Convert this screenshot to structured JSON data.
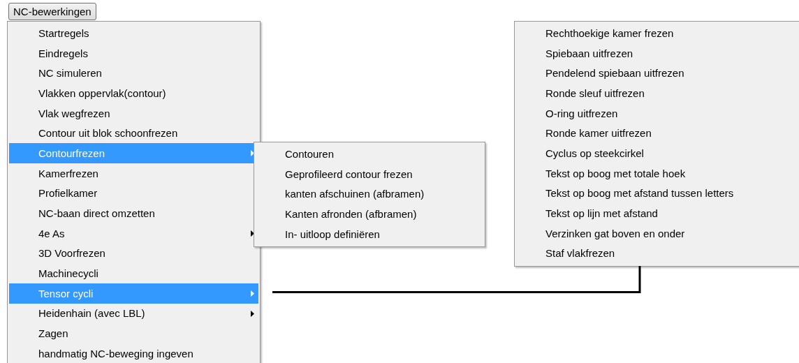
{
  "menu_button": {
    "label": "NC-bewerkingen"
  },
  "main_menu": {
    "items": [
      {
        "label": "Startregels",
        "selected": false,
        "has_submenu": false
      },
      {
        "label": "Eindregels",
        "selected": false,
        "has_submenu": false
      },
      {
        "label": "NC simuleren",
        "selected": false,
        "has_submenu": false
      },
      {
        "label": "Vlakken oppervlak(contour)",
        "selected": false,
        "has_submenu": false
      },
      {
        "label": "Vlak wegfrezen",
        "selected": false,
        "has_submenu": false
      },
      {
        "label": "Contour uit blok schoonfrezen",
        "selected": false,
        "has_submenu": false
      },
      {
        "label": "Contourfrezen",
        "selected": true,
        "has_submenu": true
      },
      {
        "label": "Kamerfrezen",
        "selected": false,
        "has_submenu": false
      },
      {
        "label": "Profielkamer",
        "selected": false,
        "has_submenu": false
      },
      {
        "label": "NC-baan direct omzetten",
        "selected": false,
        "has_submenu": false
      },
      {
        "label": "4e As",
        "selected": false,
        "has_submenu": true
      },
      {
        "label": "3D Voorfrezen",
        "selected": false,
        "has_submenu": false
      },
      {
        "label": "Machinecycli",
        "selected": false,
        "has_submenu": false
      },
      {
        "label": "Tensor cycli",
        "selected": true,
        "has_submenu": true
      },
      {
        "label": "Heidenhain (avec LBL)",
        "selected": false,
        "has_submenu": true
      },
      {
        "label": "Zagen",
        "selected": false,
        "has_submenu": false
      },
      {
        "label": "handmatig NC-beweging ingeven",
        "selected": false,
        "has_submenu": false
      }
    ]
  },
  "contourfrezen_submenu": {
    "items": [
      {
        "label": "Contouren",
        "selected": false,
        "has_submenu": false
      },
      {
        "label": "Geprofileerd contour frezen",
        "selected": false,
        "has_submenu": false
      },
      {
        "label": "kanten afschuinen (afbramen)",
        "selected": false,
        "has_submenu": false
      },
      {
        "label": "Kanten afronden (afbramen)",
        "selected": false,
        "has_submenu": false
      },
      {
        "label": "In- uitloop definiëren",
        "selected": false,
        "has_submenu": false
      }
    ]
  },
  "tensor_cycli_submenu": {
    "items": [
      {
        "label": "Rechthoekige kamer frezen",
        "selected": false,
        "has_submenu": false
      },
      {
        "label": "Spiebaan uitfrezen",
        "selected": false,
        "has_submenu": false
      },
      {
        "label": "Pendelend spiebaan uitfrezen",
        "selected": false,
        "has_submenu": false
      },
      {
        "label": "Ronde sleuf uitfrezen",
        "selected": false,
        "has_submenu": false
      },
      {
        "label": "O-ring uitfrezen",
        "selected": false,
        "has_submenu": false
      },
      {
        "label": "Ronde kamer uitfrezen",
        "selected": false,
        "has_submenu": false
      },
      {
        "label": "Cyclus op steekcirkel",
        "selected": false,
        "has_submenu": false
      },
      {
        "label": "Tekst op boog met totale hoek",
        "selected": false,
        "has_submenu": false
      },
      {
        "label": "Tekst op boog met afstand tussen letters",
        "selected": false,
        "has_submenu": false
      },
      {
        "label": "Tekst op lijn met afstand",
        "selected": false,
        "has_submenu": false
      },
      {
        "label": "Verzinken gat boven en onder",
        "selected": false,
        "has_submenu": false
      },
      {
        "label": "Staf vlakfrezen",
        "selected": false,
        "has_submenu": false
      }
    ]
  }
}
